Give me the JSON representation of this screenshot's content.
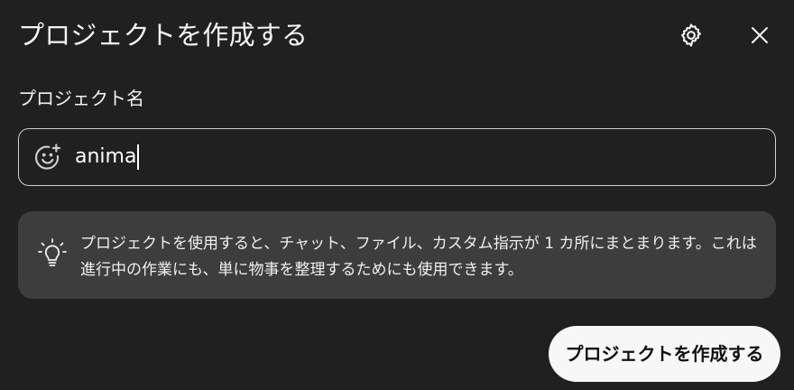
{
  "dialog": {
    "title": "プロジェクトを作成する",
    "settings_icon": "gear-icon",
    "close_icon": "close-icon"
  },
  "project_name": {
    "label": "プロジェクト名",
    "value": "anima",
    "icon": "add-emoji-icon"
  },
  "info": {
    "icon": "lightbulb-icon",
    "text": "プロジェクトを使用すると、チャット、ファイル、カスタム指示が 1 カ所にまとまります。これは進行中の作業にも、単に物事を整理するためにも使用できます。"
  },
  "actions": {
    "create_label": "プロジェクトを作成する"
  },
  "colors": {
    "background": "#202020",
    "info_background": "#3d3d3d",
    "button_background": "#f7f7f7"
  }
}
